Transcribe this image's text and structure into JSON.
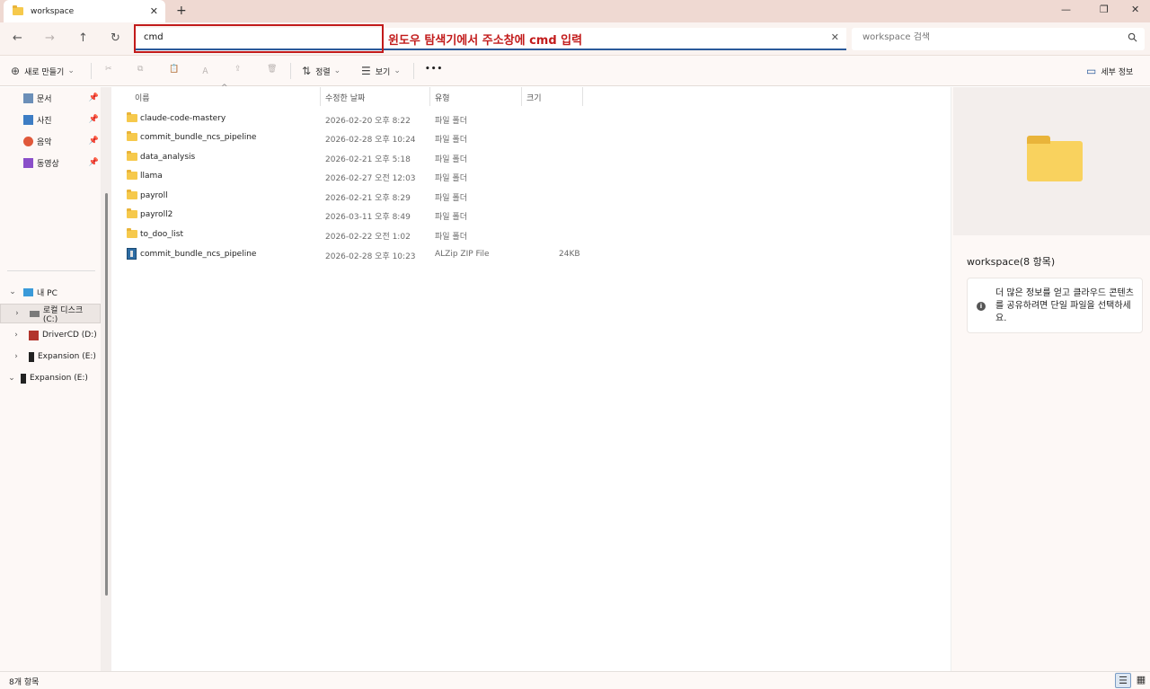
{
  "tab": {
    "title": "workspace",
    "close": "✕",
    "new_tab": "+"
  },
  "window_controls": {
    "minimize": "—",
    "maximize": "❐",
    "close": "✕"
  },
  "nav": {
    "back": "←",
    "forward": "→",
    "up": "↑",
    "refresh": "↻"
  },
  "address": {
    "value": "cmd",
    "clear": "✕"
  },
  "annotation": {
    "text": "윈도우 탐색기에서 주소창에 cmd 입력",
    "color": "#c21b1b"
  },
  "search": {
    "placeholder": "workspace 검색"
  },
  "toolbar": {
    "new_label": "새로 만들기",
    "new_caret": "⌄",
    "cut": "✂",
    "copy": "⧉",
    "paste": "📋",
    "rename": "Ａ",
    "share": "⇪",
    "delete": "🗑",
    "sort_label": "정렬",
    "sort_icon": "⇅",
    "view_label": "보기",
    "view_icon": "☰",
    "more": "•••",
    "details_label": "세부 정보",
    "details_icon": "▭"
  },
  "sidebar": {
    "quick": [
      {
        "label": "문서",
        "icon": "document-icon",
        "color": "#6b8fb8"
      },
      {
        "label": "사진",
        "icon": "picture-icon",
        "color": "#3d7dc4"
      },
      {
        "label": "음악",
        "icon": "music-icon",
        "color": "#e0583a"
      },
      {
        "label": "동영상",
        "icon": "video-icon",
        "color": "#8a4fc9"
      }
    ],
    "pin": "📌",
    "drives": [
      {
        "label": "내 PC",
        "chev": "⌄"
      },
      {
        "label": "로컬 디스크 (C:)",
        "chev": "›"
      },
      {
        "label": "DriverCD (D:)",
        "chev": "›"
      },
      {
        "label": "Expansion (E:)",
        "chev": "›"
      },
      {
        "label": "Expansion (E:)",
        "chev": "⌄"
      }
    ]
  },
  "columns": {
    "name": "이름",
    "date": "수정한 날짜",
    "type": "유형",
    "size": "크기",
    "sort_caret": "^"
  },
  "files": [
    {
      "name": "claude-code-mastery",
      "date": "2026-02-20 오후 8:22",
      "type": "파일 폴더",
      "size": "",
      "kind": "folder"
    },
    {
      "name": "commit_bundle_ncs_pipeline",
      "date": "2026-02-28 오후 10:24",
      "type": "파일 폴더",
      "size": "",
      "kind": "folder"
    },
    {
      "name": "data_analysis",
      "date": "2026-02-21 오후 5:18",
      "type": "파일 폴더",
      "size": "",
      "kind": "folder"
    },
    {
      "name": "llama",
      "date": "2026-02-27 오전 12:03",
      "type": "파일 폴더",
      "size": "",
      "kind": "folder"
    },
    {
      "name": "payroll",
      "date": "2026-02-21 오후 8:29",
      "type": "파일 폴더",
      "size": "",
      "kind": "folder"
    },
    {
      "name": "payroll2",
      "date": "2026-03-11 오후 8:49",
      "type": "파일 폴더",
      "size": "",
      "kind": "folder"
    },
    {
      "name": "to_doo_list",
      "date": "2026-02-22 오전 1:02",
      "type": "파일 폴더",
      "size": "",
      "kind": "folder"
    },
    {
      "name": "commit_bundle_ncs_pipeline",
      "date": "2026-02-28 오후 10:23",
      "type": "ALZip ZIP File",
      "size": "24KB",
      "kind": "zip"
    }
  ],
  "details": {
    "title": "workspace(8 항목)",
    "info": "더 많은 정보를 얻고 클라우드 콘텐츠를 공유하려면 단일 파일을 선택하세요.",
    "info_icon": "i"
  },
  "status": {
    "count": "8개 항목",
    "view_details": "☰",
    "view_tiles": "▦"
  }
}
